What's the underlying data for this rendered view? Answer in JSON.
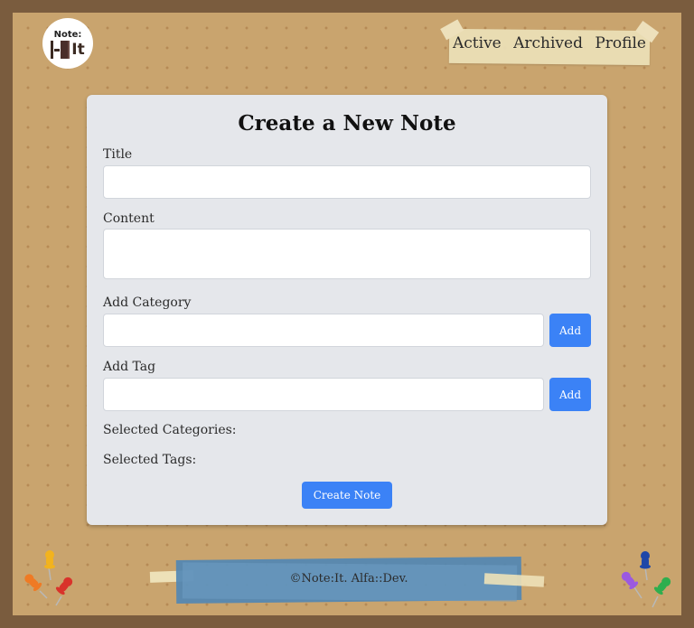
{
  "logo": {
    "top": "Note:",
    "main": "It"
  },
  "nav": [
    "Active",
    "Archived",
    "Profile"
  ],
  "form": {
    "title": "Create a New Note",
    "title_label": "Title",
    "title_value": "",
    "content_label": "Content",
    "content_value": "",
    "category_label": "Add Category",
    "category_value": "",
    "category_add": "Add",
    "tag_label": "Add Tag",
    "tag_value": "",
    "tag_add": "Add",
    "selected_categories": "Selected Categories:",
    "selected_tags": "Selected Tags:",
    "submit": "Create Note"
  },
  "footer": "©Note:It. Alfa::Dev.",
  "colors": {
    "accent": "#3b82f6",
    "board": "#c9a46e",
    "frame": "#7a5c3e",
    "card": "#e5e7eb"
  }
}
